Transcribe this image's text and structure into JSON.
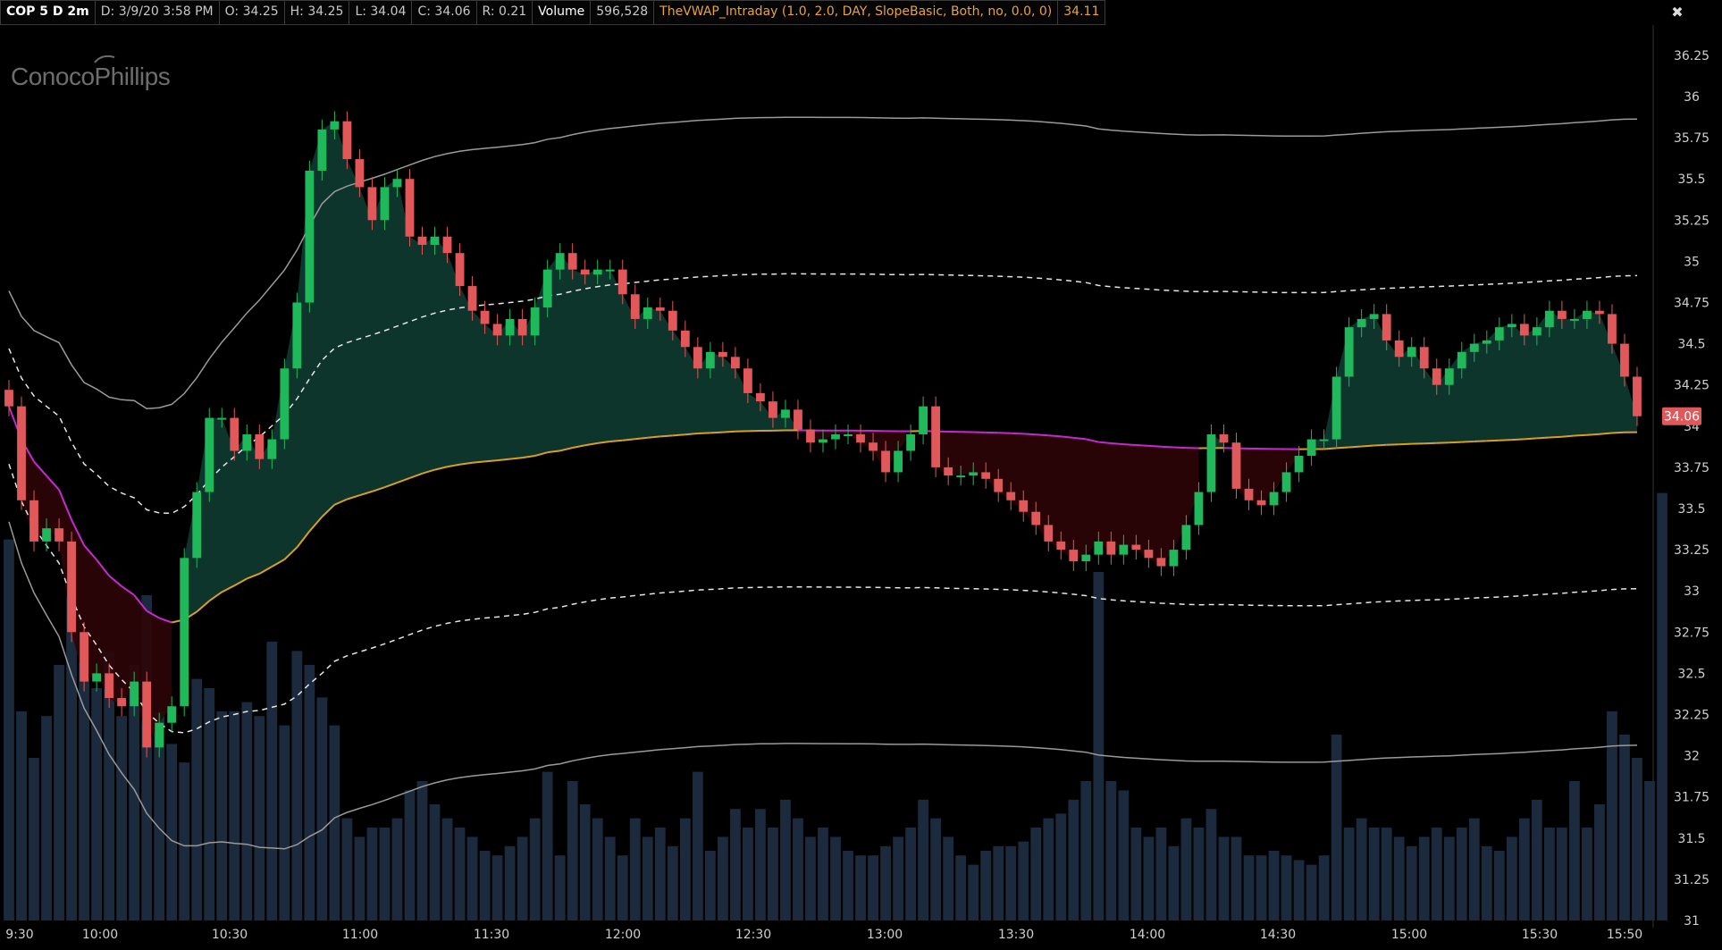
{
  "header": {
    "symbol": "COP 5 D 2m",
    "date": "D: 3/9/20 3:58 PM",
    "open": "O: 34.25",
    "high": "H: 34.25",
    "low": "L: 34.04",
    "close": "C: 34.06",
    "range": "R: 0.21",
    "volume_label": "Volume",
    "volume_value": "596,528",
    "study_label": "TheVWAP_Intraday (1.0, 2.0, DAY, SlopeBasic, Both, no, 0.0, 0)",
    "study_value": "34.11"
  },
  "logo": {
    "text": "ConocoPhillips"
  },
  "tool_icon": "crosshair-cursor-icon",
  "colors": {
    "up": "#1fb85a",
    "down": "#e0585a",
    "vwap_above": "#d9a01e",
    "vwap_below": "#c52ad0",
    "fill_up": "#0e3b30",
    "fill_down": "#2c0407",
    "band": "#9a9a9a",
    "volume": "#1c2a3e"
  },
  "chart_data": {
    "type": "candlestick",
    "title": "",
    "x_start": "9:30",
    "bar_interval_minutes": 2,
    "y_axis": {
      "ticks": [
        "36.25",
        "36",
        "35.75",
        "35.5",
        "35.25",
        "35",
        "34.75",
        "34.5",
        "34.25",
        "34",
        "33.75",
        "33.5",
        "33.25",
        "33",
        "32.75",
        "32.5",
        "32.25",
        "32",
        "31.75",
        "31.5",
        "31.25",
        "31"
      ],
      "range": [
        31,
        36.4
      ]
    },
    "x_axis": {
      "ticks": [
        "9:30",
        "10:00",
        "10:30",
        "11:00",
        "11:30",
        "12:00",
        "12:30",
        "13:00",
        "13:30",
        "14:00",
        "14:30",
        "15:00",
        "15:30",
        "15:50"
      ]
    },
    "last_price_label": "34.06",
    "closes": [
      34.12,
      33.55,
      33.3,
      33.38,
      33.3,
      32.75,
      32.45,
      32.5,
      32.35,
      32.3,
      32.45,
      32.05,
      32.2,
      32.3,
      33.2,
      33.6,
      34.05,
      34.05,
      33.85,
      33.95,
      33.8,
      33.92,
      34.35,
      34.75,
      35.55,
      35.8,
      35.85,
      35.62,
      35.45,
      35.25,
      35.45,
      35.5,
      35.15,
      35.1,
      35.15,
      35.05,
      34.85,
      34.7,
      34.62,
      34.55,
      34.65,
      34.55,
      34.72,
      34.95,
      35.05,
      34.95,
      34.92,
      34.95,
      34.95,
      34.8,
      34.65,
      34.72,
      34.7,
      34.58,
      34.48,
      34.35,
      34.45,
      34.42,
      34.35,
      34.2,
      34.15,
      34.05,
      34.1,
      33.98,
      33.9,
      33.92,
      33.95,
      33.95,
      33.9,
      33.85,
      33.72,
      33.85,
      33.95,
      34.12,
      33.75,
      33.7,
      33.7,
      33.72,
      33.68,
      33.6,
      33.55,
      33.48,
      33.4,
      33.3,
      33.25,
      33.18,
      33.22,
      33.3,
      33.22,
      33.28,
      33.25,
      33.2,
      33.15,
      33.25,
      33.4,
      33.6,
      33.95,
      33.9,
      33.62,
      33.55,
      33.52,
      33.6,
      33.72,
      33.82,
      33.92,
      33.92,
      34.3,
      34.6,
      34.65,
      34.68,
      34.52,
      34.42,
      34.48,
      34.35,
      34.25,
      34.35,
      34.45,
      34.5,
      34.52,
      34.6,
      34.62,
      34.55,
      34.6,
      34.7,
      34.65,
      34.65,
      34.7,
      34.68,
      34.5,
      34.3,
      34.06
    ],
    "volume_relative": [
      0.82,
      0.45,
      0.35,
      0.44,
      0.55,
      0.7,
      0.62,
      0.5,
      0.58,
      0.44,
      0.55,
      0.7,
      0.45,
      0.38,
      0.34,
      0.52,
      0.5,
      0.45,
      0.45,
      0.47,
      0.44,
      0.6,
      0.42,
      0.58,
      0.55,
      0.48,
      0.42,
      0.22,
      0.18,
      0.2,
      0.2,
      0.22,
      0.28,
      0.3,
      0.25,
      0.22,
      0.2,
      0.18,
      0.15,
      0.14,
      0.16,
      0.18,
      0.22,
      0.32,
      0.14,
      0.3,
      0.25,
      0.22,
      0.18,
      0.14,
      0.22,
      0.18,
      0.2,
      0.16,
      0.22,
      0.32,
      0.15,
      0.18,
      0.24,
      0.2,
      0.24,
      0.2,
      0.26,
      0.22,
      0.18,
      0.2,
      0.18,
      0.15,
      0.14,
      0.14,
      0.16,
      0.18,
      0.2,
      0.26,
      0.22,
      0.18,
      0.14,
      0.12,
      0.15,
      0.16,
      0.16,
      0.17,
      0.2,
      0.22,
      0.23,
      0.26,
      0.3,
      0.75,
      0.3,
      0.28,
      0.2,
      0.18,
      0.2,
      0.16,
      0.22,
      0.2,
      0.24,
      0.18,
      0.18,
      0.14,
      0.14,
      0.15,
      0.14,
      0.13,
      0.12,
      0.14,
      0.4,
      0.2,
      0.22,
      0.2,
      0.2,
      0.18,
      0.16,
      0.18,
      0.2,
      0.18,
      0.2,
      0.22,
      0.16,
      0.15,
      0.18,
      0.22,
      0.26,
      0.2,
      0.2,
      0.3,
      0.2,
      0.25,
      0.45,
      0.4,
      0.35,
      0.3,
      0.92
    ],
    "series": [
      {
        "name": "TheVWAP_Intraday"
      },
      {
        "name": "Volume"
      }
    ]
  }
}
